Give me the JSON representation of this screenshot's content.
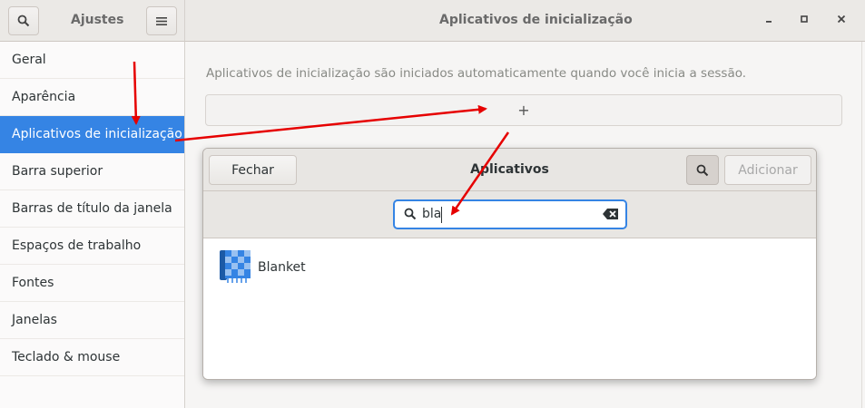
{
  "sidebar_header": {
    "title": "Ajustes",
    "search_icon": "search-icon",
    "menu_icon": "hamburger-menu-icon"
  },
  "main_header": {
    "title": "Aplicativos de inicialização",
    "minimize": "minimize-icon",
    "maximize": "maximize-icon",
    "close": "close-icon"
  },
  "sidebar": {
    "items": [
      {
        "label": "Geral"
      },
      {
        "label": "Aparência"
      },
      {
        "label": "Aplicativos de inicialização",
        "selected": true
      },
      {
        "label": "Barra superior"
      },
      {
        "label": "Barras de título da janela"
      },
      {
        "label": "Espaços de trabalho"
      },
      {
        "label": "Fontes"
      },
      {
        "label": "Janelas"
      },
      {
        "label": "Teclado & mouse"
      }
    ]
  },
  "main": {
    "description": "Aplicativos de inicialização são iniciados automaticamente quando você inicia a sessão.",
    "add_label": "+"
  },
  "dialog": {
    "title": "Aplicativos",
    "close_label": "Fechar",
    "add_label": "Adicionar",
    "search_value": "bla",
    "results": [
      {
        "name": "Blanket",
        "icon": "blanket-app-icon"
      }
    ]
  },
  "colors": {
    "accent": "#3584e4",
    "annotation_arrow": "#e60000"
  }
}
